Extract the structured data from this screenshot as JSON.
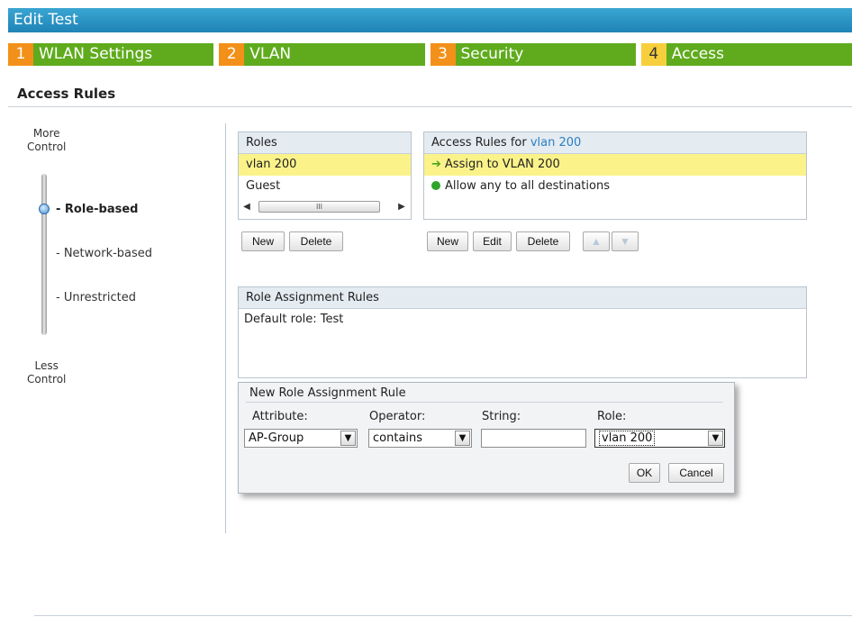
{
  "window": {
    "title": "Edit Test"
  },
  "tabs": [
    {
      "num": "1",
      "label": "WLAN Settings"
    },
    {
      "num": "2",
      "label": "VLAN"
    },
    {
      "num": "3",
      "label": "Security"
    },
    {
      "num": "4",
      "label": "Access"
    }
  ],
  "section": {
    "title": "Access Rules"
  },
  "slider": {
    "top_label": [
      "More",
      "Control"
    ],
    "bottom_label": [
      "Less",
      "Control"
    ],
    "options": [
      "- Role-based",
      "- Network-based",
      "- Unrestricted"
    ],
    "selected": "- Role-based"
  },
  "roles": {
    "header": "Roles",
    "items": [
      "vlan 200",
      "Guest"
    ],
    "selected": "vlan 200",
    "scroll_thumb": "III",
    "buttons": {
      "new": "New",
      "delete": "Delete"
    }
  },
  "access_rules": {
    "header_prefix": "Access Rules for ",
    "header_role": "vlan 200",
    "items": [
      "Assign to VLAN 200",
      "Allow any to all destinations"
    ],
    "buttons": {
      "new": "New",
      "edit": "Edit",
      "delete": "Delete"
    }
  },
  "role_assignment": {
    "header": "Role Assignment Rules",
    "default_role": "Default role: Test"
  },
  "new_rule_dialog": {
    "title": "New Role Assignment Rule",
    "labels": {
      "attribute": "Attribute:",
      "operator": "Operator:",
      "string": "String:",
      "role": "Role:"
    },
    "values": {
      "attribute": "AP-Group",
      "operator": "contains",
      "string": "",
      "role": "vlan 200"
    },
    "buttons": {
      "ok": "OK",
      "cancel": "Cancel"
    }
  },
  "colors": {
    "title_bar": "#2a95c6",
    "tab_green": "#5fab1d",
    "tab_num_orange": "#f39019",
    "tab_num_active": "#f7cf3c",
    "selection_yellow": "#fbf38a",
    "link_blue": "#2a7fc4"
  }
}
